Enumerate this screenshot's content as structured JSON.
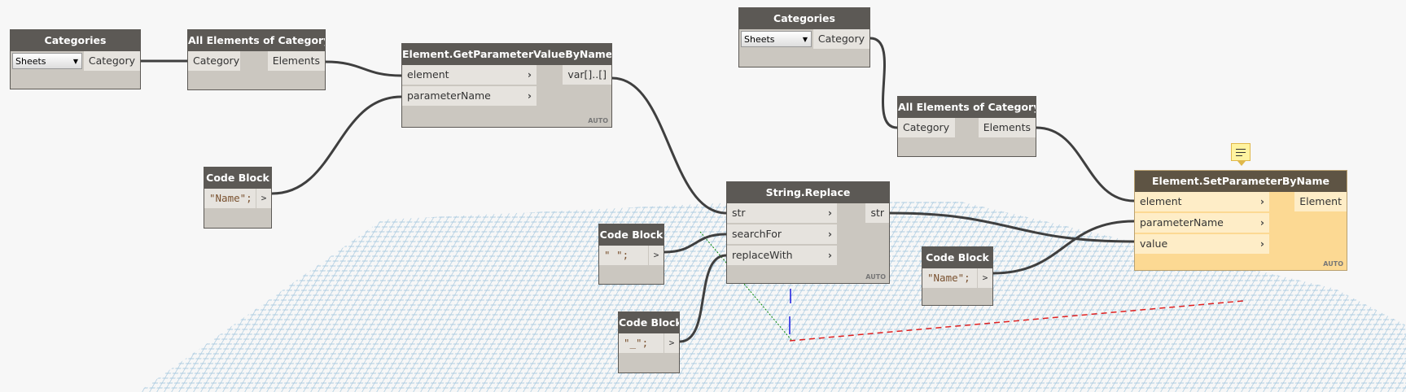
{
  "nodes": [
    {
      "id": "categories-1",
      "title": "Categories",
      "dropdown": "Sheets",
      "inputs": [],
      "outputs": [
        "Category"
      ]
    },
    {
      "id": "all-elements-1",
      "title": "All Elements of Category",
      "inputs": [
        "Category"
      ],
      "outputs": [
        "Elements"
      ],
      "plain_inputs": true
    },
    {
      "id": "get-parameter",
      "title": "Element.GetParameterValueByName",
      "inputs": [
        "element",
        "parameterName"
      ],
      "outputs": [
        "var[]..[]"
      ],
      "lacing": "AUTO"
    },
    {
      "id": "code-block-name-1",
      "title": "Code Block",
      "code": "\"Name\";",
      "go": ">"
    },
    {
      "id": "categories-2",
      "title": "Categories",
      "dropdown": "Sheets",
      "inputs": [],
      "outputs": [
        "Category"
      ]
    },
    {
      "id": "all-elements-2",
      "title": "All Elements of Category",
      "inputs": [
        "Category"
      ],
      "outputs": [
        "Elements"
      ],
      "plain_inputs": true
    },
    {
      "id": "string-replace",
      "title": "String.Replace",
      "inputs": [
        "str",
        "searchFor",
        "replaceWith"
      ],
      "outputs": [
        "str"
      ],
      "lacing": "AUTO"
    },
    {
      "id": "code-block-space",
      "title": "Code Block",
      "code": "\" \";",
      "go": ">"
    },
    {
      "id": "code-block-underscore",
      "title": "Code Block",
      "code": "\"_\";",
      "go": ">"
    },
    {
      "id": "code-block-name-2",
      "title": "Code Block",
      "code": "\"Name\";",
      "go": ">"
    },
    {
      "id": "set-parameter",
      "title": "Element.SetParameterByName",
      "inputs": [
        "element",
        "parameterName",
        "value"
      ],
      "outputs": [
        "Element"
      ],
      "lacing": "AUTO",
      "selected": true
    }
  ],
  "icons": {
    "chevron": "chevron-right-icon",
    "note": "comment-note-icon",
    "dropdown": "caret-down-icon"
  },
  "colors": {
    "wire": "#3f3f3f",
    "header": "#5c5955",
    "node_body": "#cbc7c0",
    "selected_body": "#fcd993",
    "grid": "#9fc3dc"
  }
}
